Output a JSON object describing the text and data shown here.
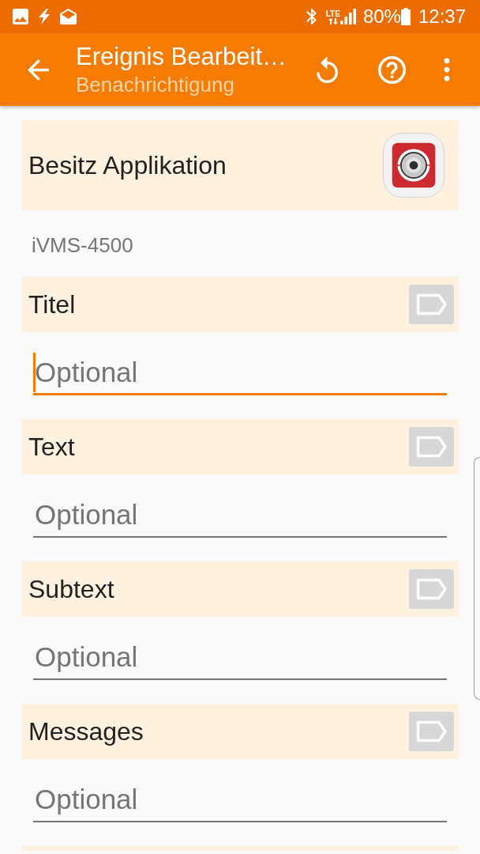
{
  "status_bar": {
    "network_type": "LTE",
    "battery": "80%",
    "time": "12:37"
  },
  "app_bar": {
    "title": "Ereignis Bearbeit…",
    "subtitle": "Benachrichtigung"
  },
  "application": {
    "label": "Besitz Applikation",
    "name": "iVMS-4500"
  },
  "fields": [
    {
      "label": "Titel",
      "placeholder": "Optional",
      "focused": true
    },
    {
      "label": "Text",
      "placeholder": "Optional",
      "focused": false
    },
    {
      "label": "Subtext",
      "placeholder": "Optional",
      "focused": false
    },
    {
      "label": "Messages",
      "placeholder": "Optional",
      "focused": false
    }
  ]
}
